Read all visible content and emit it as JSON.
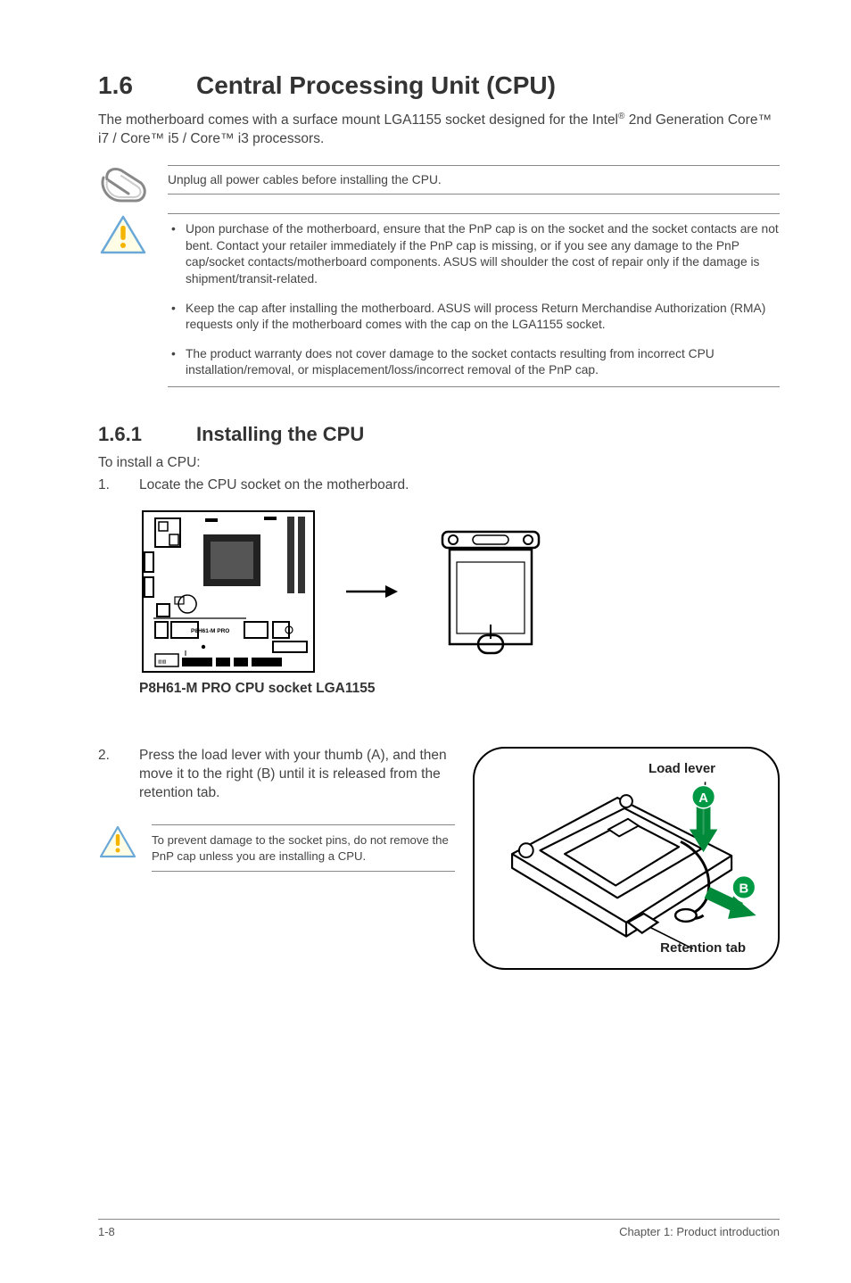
{
  "section": {
    "number": "1.6",
    "title": "Central Processing Unit (CPU)"
  },
  "intro_pre": "The motherboard comes with a surface mount LGA1155 socket designed for the Intel",
  "intro_sup": "®",
  "intro_post": " 2nd Generation Core™ i7 / Core™ i5 / Core™ i3 processors.",
  "note_unplug": "Unplug all power cables before installing the CPU.",
  "warnings": [
    "Upon purchase of the motherboard, ensure that the PnP cap is on the socket and the socket contacts are not bent. Contact your retailer immediately if the PnP cap is missing, or if you see any damage to the PnP cap/socket contacts/motherboard components. ASUS will shoulder the cost of repair only if the damage is shipment/transit-related.",
    "Keep the cap after installing the motherboard. ASUS will process Return Merchandise Authorization (RMA) requests only if the motherboard comes with the cap on the LGA1155 socket.",
    "The product warranty does not cover damage to the socket contacts resulting from incorrect CPU installation/removal, or misplacement/loss/incorrect removal of the PnP cap."
  ],
  "subsection": {
    "number": "1.6.1",
    "title": "Installing the CPU"
  },
  "install_intro": "To install a CPU:",
  "steps": {
    "s1_num": "1.",
    "s1_text": "Locate the CPU socket on the motherboard.",
    "s2_num": "2.",
    "s2_text": "Press the load lever with your thumb (A), and then move it to the right (B) until it is released from the retention tab."
  },
  "figure_board_label": "P8H61-M PRO",
  "figure_caption": "P8H61-M PRO CPU socket LGA1155",
  "inner_warning": "To prevent damage to the socket pins, do not remove the PnP cap unless you are installing a CPU.",
  "callout": {
    "top": "Load lever",
    "bottom": "Retention tab",
    "badgeA": "A",
    "badgeB": "B"
  },
  "footer": {
    "left": "1-8",
    "right": "Chapter 1: Product introduction"
  }
}
